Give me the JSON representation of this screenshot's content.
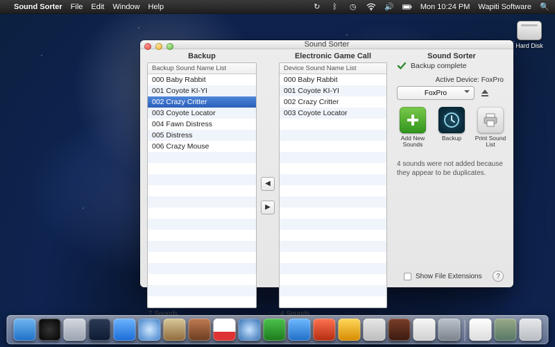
{
  "menubar": {
    "app": "Sound Sorter",
    "items": [
      "File",
      "Edit",
      "Window",
      "Help"
    ],
    "clock": "Mon 10:24 PM",
    "company": "Wapiti Software"
  },
  "desktop": {
    "hard_disk_label": "Hard Disk"
  },
  "window": {
    "title": "Sound Sorter",
    "backup": {
      "heading": "Backup",
      "list_header": "Backup Sound Name List",
      "items": [
        "000 Baby Rabbit",
        "001 Coyote KI-YI",
        "002 Crazy Critter",
        "003 Coyote Locator",
        "004 Fawn Distress",
        "005 Distress",
        "006 Crazy Mouse"
      ],
      "selected_index": 2,
      "count_label": "7 Sounds"
    },
    "device": {
      "heading": "Electronic Game Call",
      "list_header": "Device Sound Name List",
      "items": [
        "000 Baby Rabbit",
        "001 Coyote KI-YI",
        "002 Crazy Critter",
        "003 Coyote Locator"
      ],
      "count_label": "4 Sounds"
    },
    "side": {
      "heading": "Sound Sorter",
      "status_text": "Backup complete",
      "active_device_label": "Active Device: FoxPro",
      "device_select": "FoxPro",
      "actions": {
        "add": "Add New Sounds",
        "backup": "Backup",
        "print": "Print Sound List"
      },
      "message": "4 sounds were not added because they appear to be duplicates."
    },
    "footer": {
      "show_ext_label": "Show File Extensions"
    }
  },
  "dock": {
    "apps": [
      "finder",
      "dashboard",
      "launchpad",
      "mission-control",
      "appstore",
      "safari",
      "mail",
      "contacts",
      "calendar",
      "itunes",
      "facetime",
      "ichat",
      "photobooth",
      "iphoto",
      "preview",
      "dictionary",
      "textedit",
      "systemprefs"
    ],
    "right": [
      "documents",
      "downloads",
      "trash"
    ]
  }
}
